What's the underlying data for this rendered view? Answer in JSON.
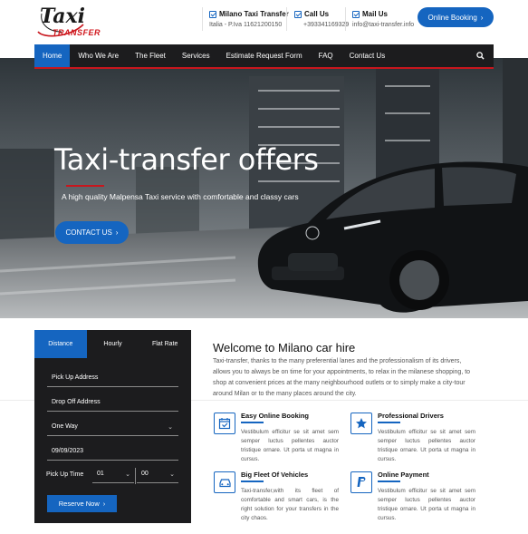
{
  "brand": {
    "logo_word": "Taxi",
    "logo_sub": "TRANSFER"
  },
  "header": {
    "contacts": [
      {
        "title": "Milano Taxi Transfer",
        "sub": "Italia - P.Iva 11621200150"
      },
      {
        "title": "Call Us",
        "sub": "+393341169329"
      },
      {
        "title": "Mail Us",
        "sub": "info@taxi-transfer.info"
      }
    ],
    "booking_button": "Online Booking"
  },
  "nav": {
    "items": [
      "Home",
      "Who We Are",
      "The Fleet",
      "Services",
      "Estimate Request Form",
      "FAQ",
      "Contact Us"
    ],
    "active_index": 0
  },
  "hero": {
    "title": "Taxi-transfer offers",
    "subtitle": "A high quality Malpensa Taxi service with comfortable and classy cars",
    "button": "CONTACT US"
  },
  "booking": {
    "tabs": [
      "Distance",
      "Hourly",
      "Flat Rate"
    ],
    "active_tab": 0,
    "pickup_placeholder": "Pick Up Address",
    "dropoff_placeholder": "Drop Off Address",
    "trip_type": "One Way",
    "date": "09/09/2023",
    "pickup_time_label": "Pick Up Time",
    "hour": "01",
    "minute": "00",
    "reserve_button": "Reserve Now"
  },
  "welcome": {
    "title": "Welcome to Milano car hire",
    "text": "Taxi-transfer, thanks to the many preferential lanes and the professionalism of its drivers, allows you to always be on time for your appointments, to relax in the milanese shopping, to shop at convenient prices at the many neighbourhood outlets or to simply make a city-tour around Milan or to the many places around the city."
  },
  "features": [
    {
      "title": "Easy Online Booking",
      "text": "Vestibulum efficitur se sit amet sem semper luctus pellentes auctor tristique ornare. Ut porta ut magna in cursus.",
      "icon": "calendar-check-icon"
    },
    {
      "title": "Professional Drivers",
      "text": "Vestibulum efficitur se sit amet sem semper luctus pellentes auctor tristique ornare. Ut porta ut magna in cursus.",
      "icon": "star-icon"
    },
    {
      "title": "Big Fleet Of Vehicles",
      "text": "Taxi-transfer,with its fleet of comfortable and smart cars, is the right solution for your transfers in the city chaos.",
      "icon": "car-icon"
    },
    {
      "title": "Online Payment",
      "text": "Vestibulum efficitur se sit amet sem semper luctus pellentes auctor tristique ornare. Ut porta ut magna in cursus.",
      "icon": "paypal-icon"
    }
  ],
  "colors": {
    "primary": "#1565c0",
    "accent": "#c8161d",
    "dark": "#1c1c1e"
  }
}
